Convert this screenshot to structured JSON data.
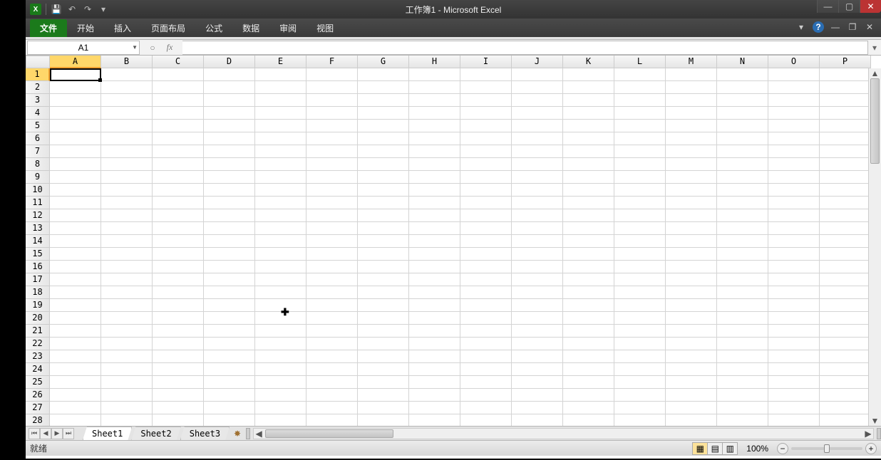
{
  "title": "工作簿1 - Microsoft Excel",
  "qat": {
    "app": "X"
  },
  "tabs": {
    "file": "文件",
    "items": [
      "开始",
      "插入",
      "页面布局",
      "公式",
      "数据",
      "审阅",
      "视图"
    ]
  },
  "name_box": "A1",
  "fx_label": "fx",
  "columns": [
    "A",
    "B",
    "C",
    "D",
    "E",
    "F",
    "G",
    "H",
    "I",
    "J",
    "K",
    "L",
    "M",
    "N",
    "O",
    "P"
  ],
  "rows": [
    "1",
    "2",
    "3",
    "4",
    "5",
    "6",
    "7",
    "8",
    "9",
    "10",
    "11",
    "12",
    "13",
    "14",
    "15",
    "16",
    "17",
    "18",
    "19",
    "20",
    "21",
    "22",
    "23",
    "24",
    "25",
    "26",
    "27",
    "28"
  ],
  "active_col": "A",
  "active_row": "1",
  "sheets": [
    "Sheet1",
    "Sheet2",
    "Sheet3"
  ],
  "active_sheet": "Sheet1",
  "status": "就绪",
  "zoom": "100%"
}
